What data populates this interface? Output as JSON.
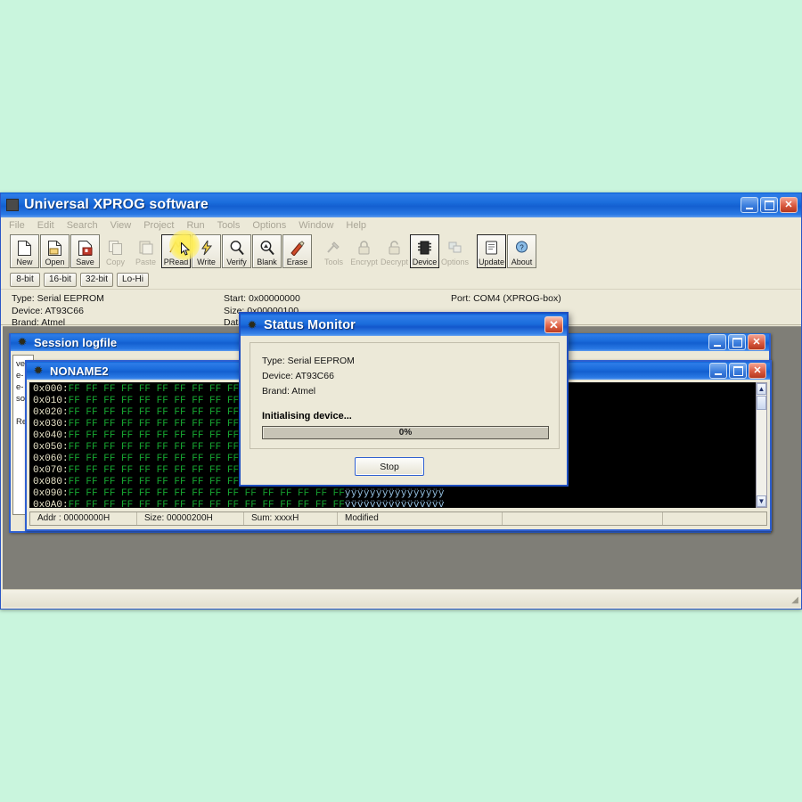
{
  "app": {
    "title": "Universal XPROG software",
    "icon": "app-icon",
    "window_buttons": {
      "minimize": "_",
      "maximize": "□",
      "close": "✕"
    },
    "menu": [
      "File",
      "Edit",
      "Search",
      "View",
      "Project",
      "Run",
      "Tools",
      "Options",
      "Window",
      "Help"
    ],
    "toolbar": [
      {
        "label": "New",
        "icon": "new-file-icon",
        "state": "enabled"
      },
      {
        "label": "Open",
        "icon": "open-folder-icon",
        "state": "enabled"
      },
      {
        "label": "Save",
        "icon": "save-disk-icon",
        "state": "enabled"
      },
      {
        "label": "Copy",
        "icon": "copy-icon",
        "state": "disabled"
      },
      {
        "label": "Paste",
        "icon": "paste-icon",
        "state": "disabled"
      },
      {
        "label": "PRead",
        "icon": "pread-icon",
        "state": "hover"
      },
      {
        "label": "Write",
        "icon": "write-bolt-icon",
        "state": "enabled"
      },
      {
        "label": "Verify",
        "icon": "verify-magnifier-icon",
        "state": "enabled"
      },
      {
        "label": "Blank",
        "icon": "blank-magnifier-icon",
        "state": "enabled"
      },
      {
        "label": "Erase",
        "icon": "erase-brush-icon",
        "state": "enabled"
      },
      {
        "label": "Tools",
        "icon": "tools-icon",
        "state": "disabled"
      },
      {
        "label": "Encrypt",
        "icon": "lock-closed-icon",
        "state": "disabled"
      },
      {
        "label": "Decrypt",
        "icon": "lock-open-icon",
        "state": "disabled"
      },
      {
        "label": "Device",
        "icon": "chip-icon",
        "state": "enabled"
      },
      {
        "label": "Options",
        "icon": "options-icon",
        "state": "disabled"
      },
      {
        "label": "Update",
        "icon": "update-icon",
        "state": "enabled"
      },
      {
        "label": "About",
        "icon": "about-icon",
        "state": "enabled"
      }
    ],
    "mode_buttons": [
      "8-bit",
      "16-bit",
      "32-bit",
      "Lo-Hi"
    ],
    "info": {
      "type": "Type: Serial EEPROM",
      "device": "Device: AT93C66",
      "brand": "Brand: Atmel",
      "start": "Start: 0x00000000",
      "size": "Size: 0x00000100",
      "data": "Data:",
      "port": "Port: COM4 (XPROG-box)"
    },
    "statusbar": ""
  },
  "session_window": {
    "title": "Session logfile",
    "icon": "moth-icon",
    "log_fragments": [
      "ve",
      "e-",
      "e-",
      "so",
      "",
      "Re"
    ],
    "window_buttons": {
      "minimize": "_",
      "maximize": "□",
      "close": "✕"
    }
  },
  "hex_window": {
    "title": "NONAME2",
    "icon": "moth-icon",
    "window_buttons": {
      "minimize": "_",
      "maximize": "□",
      "close": "✕"
    },
    "rows": [
      {
        "addr": "0x000:",
        "bytes": "FF FF FF FF FF FF FF FF FF FF FF FF FF FF FF FF",
        "ascii": ""
      },
      {
        "addr": "0x010:",
        "bytes": "FF FF FF FF FF FF FF FF FF FF FF FF FF FF FF FF",
        "ascii": ""
      },
      {
        "addr": "0x020:",
        "bytes": "FF FF FF FF FF FF FF FF FF FF FF FF FF FF FF FF",
        "ascii": ""
      },
      {
        "addr": "0x030:",
        "bytes": "FF FF FF FF FF FF FF FF FF FF FF FF FF FF FF FF",
        "ascii": ""
      },
      {
        "addr": "0x040:",
        "bytes": "FF FF FF FF FF FF FF FF FF FF FF FF FF FF FF FF",
        "ascii": ""
      },
      {
        "addr": "0x050:",
        "bytes": "FF FF FF FF FF FF FF FF FF FF FF FF FF FF FF FF",
        "ascii": ""
      },
      {
        "addr": "0x060:",
        "bytes": "FF FF FF FF FF FF FF FF FF FF FF FF FF FF FF FF",
        "ascii": ""
      },
      {
        "addr": "0x070:",
        "bytes": "FF FF FF FF FF FF FF FF FF FF FF FF FF FF FF FF",
        "ascii": ""
      },
      {
        "addr": "0x080:",
        "bytes": "FF FF FF FF FF FF FF FF FF FF FF FF FF FF FF FF",
        "ascii": ""
      },
      {
        "addr": "0x090:",
        "bytes": "FF FF FF FF FF FF FF FF FF FF FF FF FF FF FF FF",
        "ascii": "ÿÿÿÿÿÿÿÿÿÿÿÿÿÿÿÿ"
      },
      {
        "addr": "0x0A0:",
        "bytes": "FF FF FF FF FF FF FF FF FF FF FF FF FF FF FF FF",
        "ascii": "ÿÿÿÿÿÿÿÿÿÿÿÿÿÿÿÿ"
      }
    ],
    "status": {
      "addr": "Addr : 00000000H",
      "size": "Size: 00000200H",
      "sum": "Sum: xxxxH",
      "modified": "Modified"
    },
    "scrollbar": {
      "up": "▲",
      "down": "▼"
    }
  },
  "status_dialog": {
    "title": "Status Monitor",
    "icon": "moth-icon",
    "close_button": "✕",
    "type": "Type: Serial EEPROM",
    "device": "Device: AT93C66",
    "brand": "Brand: Atmel",
    "progress_label": "Initialising device...",
    "progress_percent": "0%",
    "progress_value": 0,
    "stop_button": "Stop"
  },
  "colors": {
    "page_background": "#c9f5dd",
    "titlebar_blue": "#1b6ddc",
    "window_face": "#ece9d8",
    "mdi_background": "#7f7e77",
    "hex_background": "#000000",
    "hex_byte_green": "#17a832",
    "hex_addr_cream": "#e8e4c8",
    "hex_ascii_blue": "#9ecdf0",
    "hover_highlight": "#ffee58",
    "close_button_red": "#d9593f"
  }
}
